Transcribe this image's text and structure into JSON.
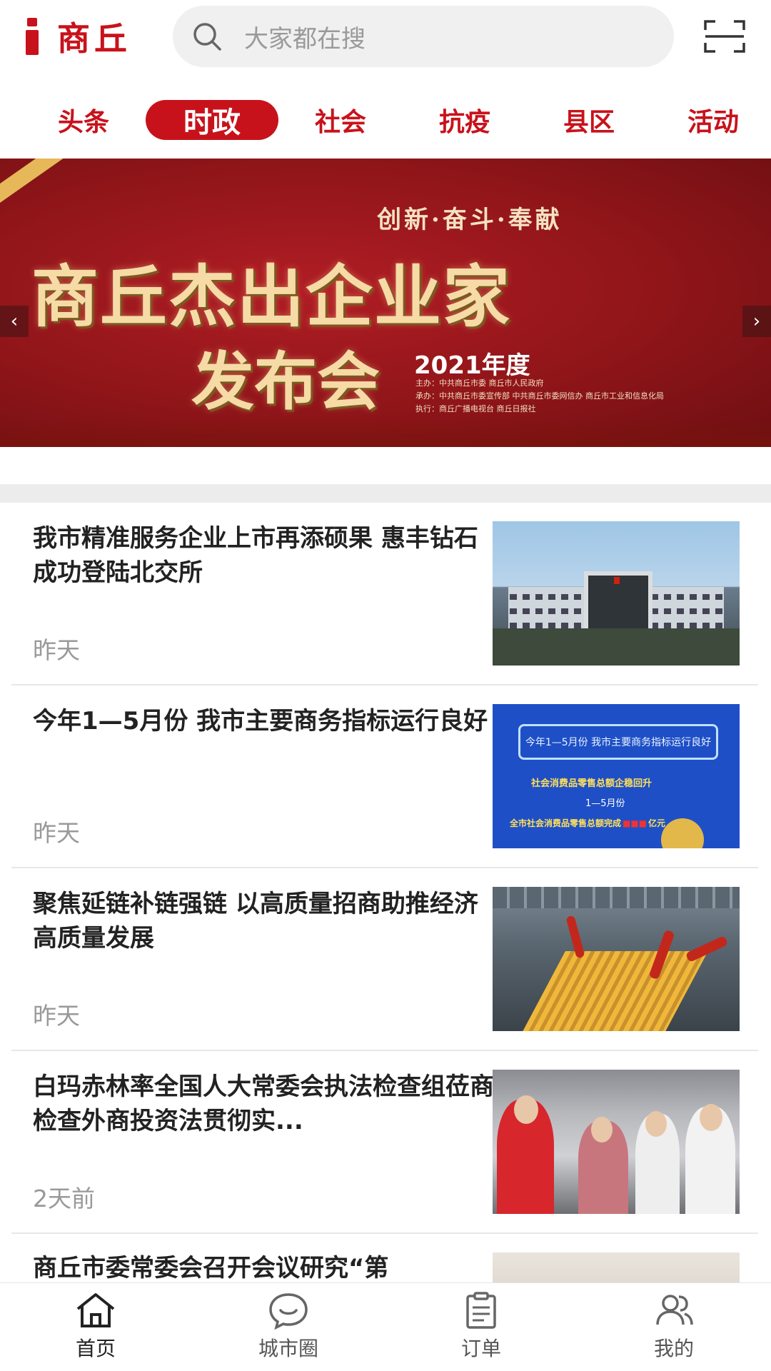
{
  "header": {
    "logo_text": "商丘",
    "search_placeholder": "大家都在搜"
  },
  "tabs": [
    {
      "label": "头条",
      "active": false
    },
    {
      "label": "时政",
      "active": true
    },
    {
      "label": "社会",
      "active": false
    },
    {
      "label": "抗疫",
      "active": false
    },
    {
      "label": "县区",
      "active": false
    },
    {
      "label": "活动",
      "active": false
    }
  ],
  "banner": {
    "slogan": "创新·奋斗·奉献",
    "headline_line1": "商丘杰出企业家",
    "headline_line2": "发布会",
    "year": "2021年度",
    "credits": [
      "主办：中共商丘市委  商丘市人民政府",
      "承办：中共商丘市委宣传部  中共商丘市委网信办  商丘市工业和信息化局",
      "执行：商丘广播电视台  商丘日报社"
    ]
  },
  "news": [
    {
      "title": "我市精准服务企业上市再添硕果 惠丰钻石成功登陆北交所",
      "time": "昨天"
    },
    {
      "title": "今年1—5月份 我市主要商务指标运行良好",
      "time": "昨天",
      "thumb_text": {
        "box": "今年1—5月份 我市主要商务指标运行良好",
        "l1": "社会消费品零售总额企稳回升",
        "l2": "1—5月份",
        "l3": "全市社会消费品零售总额完成",
        "l3_tail": "亿元"
      }
    },
    {
      "title": "聚焦延链补链强链 以高质量招商助推经济高质量发展",
      "time": "昨天"
    },
    {
      "title": "白玛赤林率全国人大常委会执法检查组莅商检查外商投资法贯彻实...",
      "time": "2天前"
    },
    {
      "title": "商丘市委常委会召开会议研究“第",
      "time": ""
    }
  ],
  "bottom_nav": [
    {
      "label": "首页",
      "icon": "home-icon",
      "active": true
    },
    {
      "label": "城市圈",
      "icon": "chat-bubble-icon",
      "active": false
    },
    {
      "label": "订单",
      "icon": "clipboard-icon",
      "active": false
    },
    {
      "label": "我的",
      "icon": "users-icon",
      "active": false
    }
  ],
  "colors": {
    "brand_red": "#c8121b",
    "muted_text": "#999999"
  }
}
